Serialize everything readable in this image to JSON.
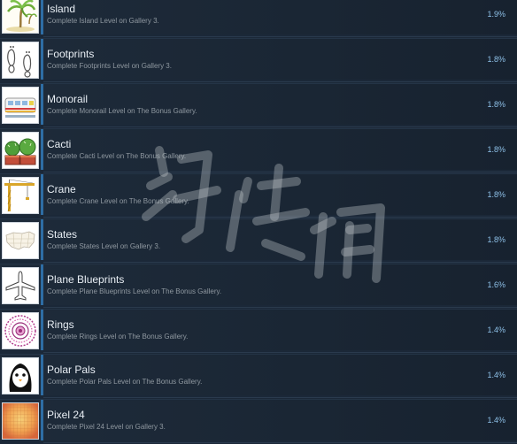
{
  "achievements": [
    {
      "title": "Island",
      "desc": "Complete Island Level on Gallery 3.",
      "percent": "1.9%",
      "icon": "palm-tree-icon"
    },
    {
      "title": "Footprints",
      "desc": "Complete Footprints Level on Gallery 3.",
      "percent": "1.8%",
      "icon": "footprints-icon"
    },
    {
      "title": "Monorail",
      "desc": "Complete Monorail Level on The Bonus Gallery.",
      "percent": "1.8%",
      "icon": "monorail-icon"
    },
    {
      "title": "Cacti",
      "desc": "Complete Cacti Level on The Bonus Gallery.",
      "percent": "1.8%",
      "icon": "cacti-icon"
    },
    {
      "title": "Crane",
      "desc": "Complete Crane Level on The Bonus Gallery.",
      "percent": "1.8%",
      "icon": "crane-icon"
    },
    {
      "title": "States",
      "desc": "Complete States Level on Gallery 3.",
      "percent": "1.8%",
      "icon": "map-icon"
    },
    {
      "title": "Plane Blueprints",
      "desc": "Complete Plane Blueprints Level on The Bonus Gallery.",
      "percent": "1.6%",
      "icon": "airplane-icon"
    },
    {
      "title": "Rings",
      "desc": "Complete Rings Level on The Bonus Gallery.",
      "percent": "1.4%",
      "icon": "rings-icon"
    },
    {
      "title": "Polar Pals",
      "desc": "Complete Polar Pals Level on The Bonus Gallery.",
      "percent": "1.4%",
      "icon": "penguin-icon"
    },
    {
      "title": "Pixel 24",
      "desc": "Complete Pixel 24 Level on Gallery 3.",
      "percent": "1.4%",
      "icon": "pixel-grid-icon"
    }
  ],
  "colors": {
    "background": "#1b2838",
    "accent_bar": "#2e6da4",
    "percent_text": "#8ec0e8"
  },
  "watermark": {
    "text": "游侠网"
  }
}
